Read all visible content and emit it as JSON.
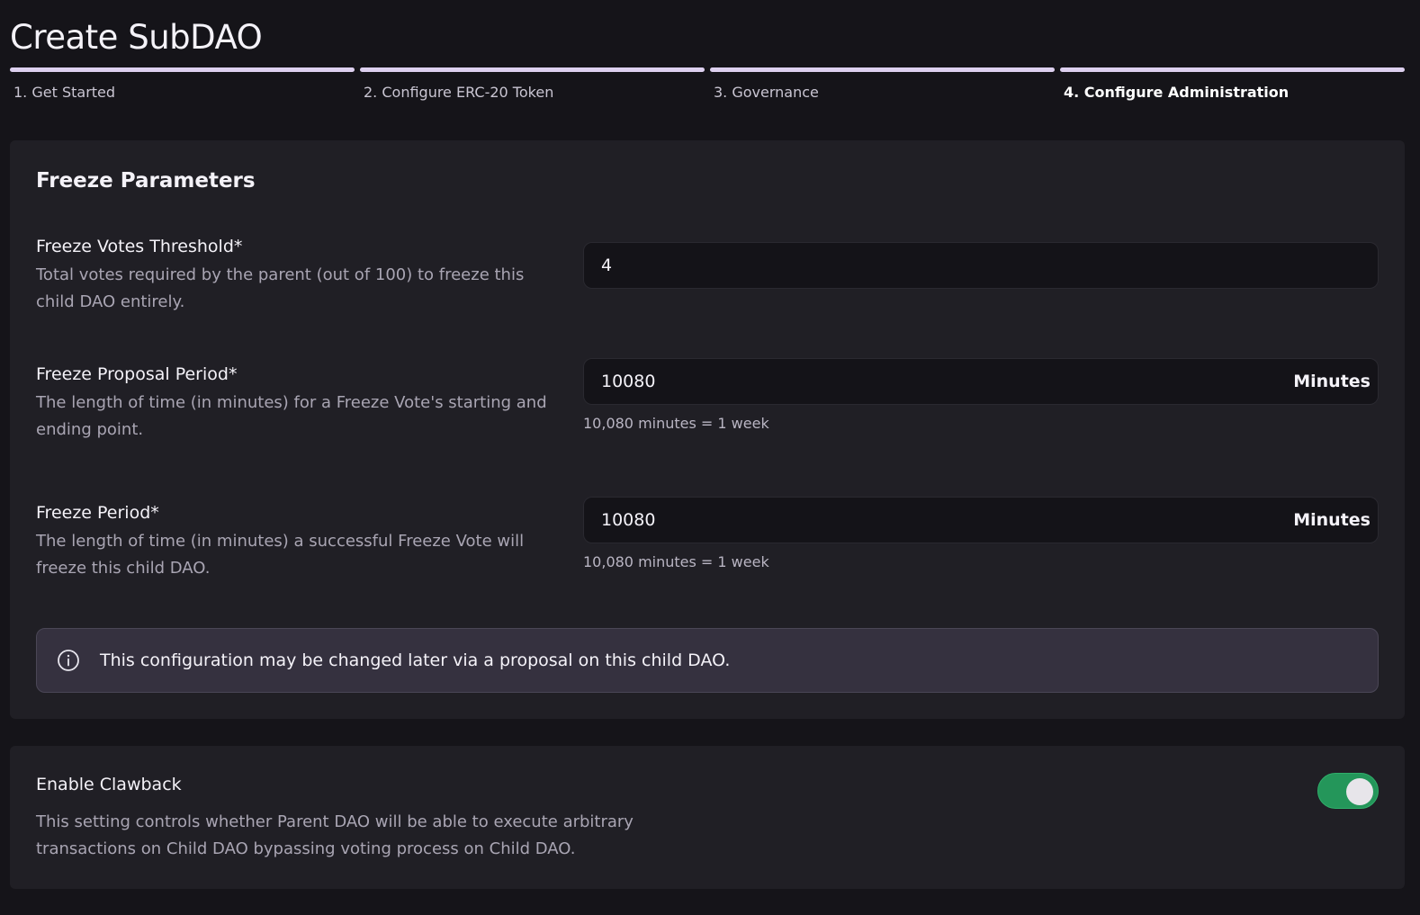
{
  "page": {
    "title": "Create SubDAO"
  },
  "steps": [
    {
      "label": "1. Get Started"
    },
    {
      "label": "2. Configure ERC-20 Token"
    },
    {
      "label": "3. Governance"
    },
    {
      "label": "4. Configure Administration"
    }
  ],
  "freeze": {
    "title": "Freeze Parameters",
    "votes_threshold": {
      "label": "Freeze Votes Threshold*",
      "description": "Total votes required by the parent (out of 100) to freeze this child DAO entirely.",
      "value": "4"
    },
    "proposal_period": {
      "label": "Freeze Proposal Period*",
      "description": "The length of time (in minutes) for a Freeze Vote's starting and ending point.",
      "value": "10080",
      "unit": "Minutes",
      "helper": "10,080 minutes = 1 week"
    },
    "freeze_period": {
      "label": "Freeze Period*",
      "description": "The length of time (in minutes) a successful Freeze Vote will freeze this child DAO.",
      "value": "10080",
      "unit": "Minutes",
      "helper": "10,080 minutes = 1 week"
    },
    "info": "This configuration may be changed later via a proposal on this child DAO."
  },
  "clawback": {
    "title": "Enable Clawback",
    "description": "This setting controls whether Parent DAO will be able to execute arbitrary transactions on Child DAO bypassing voting process on Child DAO.",
    "enabled": true
  },
  "icons": {
    "info": "info-circle-icon"
  },
  "colors": {
    "background": "#151419",
    "card": "#201f25",
    "step_bar": "#ddd0ef",
    "toggle_on": "#24965a"
  }
}
